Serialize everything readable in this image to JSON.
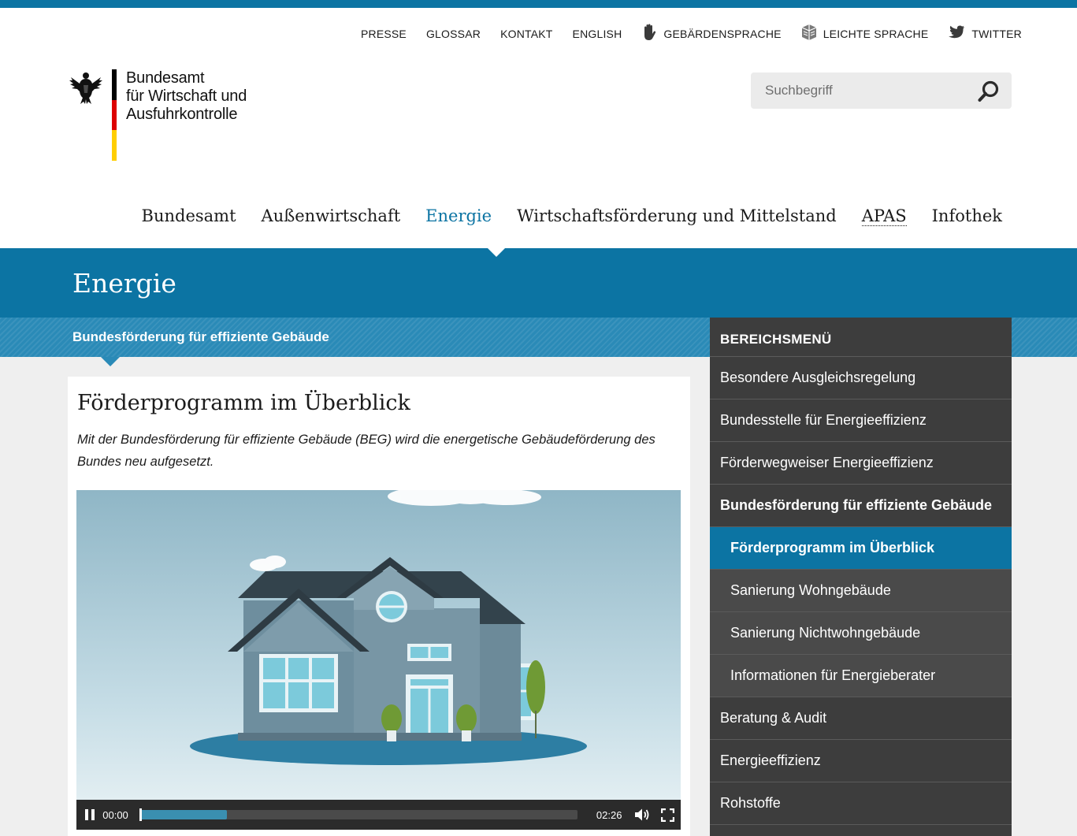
{
  "service_nav": [
    {
      "label": "PRESSE",
      "icon": ""
    },
    {
      "label": "GLOSSAR",
      "icon": ""
    },
    {
      "label": "KONTAKT",
      "icon": ""
    },
    {
      "label": "ENGLISH",
      "icon": ""
    },
    {
      "label": "GEBÄRDENSPRACHE",
      "icon": "hand-icon"
    },
    {
      "label": "LEICHTE SPRACHE",
      "icon": "easy-language-icon"
    },
    {
      "label": "TWITTER",
      "icon": "twitter-icon"
    }
  ],
  "logo": {
    "line1": "Bundesamt",
    "line2": "für Wirtschaft und",
    "line3": "Ausfuhrkontrolle",
    "flag_colors": [
      "#000000",
      "#dd0000",
      "#ffce00"
    ]
  },
  "search": {
    "placeholder": "Suchbegriff",
    "icon": "search-icon"
  },
  "main_nav": [
    {
      "label": "Bundesamt",
      "active": false
    },
    {
      "label": "Außenwirtschaft",
      "active": false
    },
    {
      "label": "Energie",
      "active": true
    },
    {
      "label": "Wirtschaftsförderung und Mittelstand",
      "active": false
    },
    {
      "label": "APAS",
      "active": false
    },
    {
      "label": "Infothek",
      "active": false
    }
  ],
  "section": {
    "title": "Energie",
    "subtitle": "Bundesförderung für effiziente Gebäude"
  },
  "article": {
    "title": "Förderprogramm im Überblick",
    "teaser": "Mit der Bundesförderung für effiziente Gebäude (BEG) wird die energetische Gebäudeförderung des Bundes neu aufgesetzt."
  },
  "video": {
    "current_time": "00:00",
    "duration": "02:26",
    "buffered_fraction": 0.2,
    "state": "playing",
    "pause_icon": "pause-icon",
    "volume_icon": "volume-icon",
    "fullscreen_icon": "fullscreen-icon"
  },
  "sidebar": {
    "heading": "BEREICHSMENÜ",
    "items": [
      {
        "label": "Besondere Ausgleichsregelung",
        "level": 1,
        "active": false,
        "bold": false
      },
      {
        "label": "Bundesstelle für Energieeffizienz",
        "level": 1,
        "active": false,
        "bold": false
      },
      {
        "label": "Förderwegweiser Energieeffizienz",
        "level": 1,
        "active": false,
        "bold": false
      },
      {
        "label": "Bundesförderung für effiziente Gebäude",
        "level": 1,
        "active": false,
        "bold": true
      },
      {
        "label": "Förderprogramm im Überblick",
        "level": 2,
        "active": true,
        "bold": true
      },
      {
        "label": "Sanierung Wohngebäude",
        "level": 2,
        "active": false,
        "bold": false
      },
      {
        "label": "Sanierung Nichtwohngebäude",
        "level": 2,
        "active": false,
        "bold": false
      },
      {
        "label": "Informationen für Energieberater",
        "level": 2,
        "active": false,
        "bold": false
      },
      {
        "label": "Beratung & Audit",
        "level": 1,
        "active": false,
        "bold": false
      },
      {
        "label": "Energieeffizienz",
        "level": 1,
        "active": false,
        "bold": false
      },
      {
        "label": "Rohstoffe",
        "level": 1,
        "active": false,
        "bold": false
      }
    ]
  },
  "colors": {
    "accent": "#0c74a3",
    "sidebar_bg": "#3d3d3d",
    "band_light": "#2a8ab7"
  }
}
